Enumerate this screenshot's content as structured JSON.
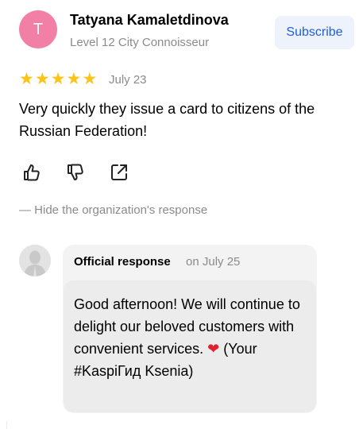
{
  "author": {
    "initial": "T",
    "name": "Tatyana Kamaletdinova",
    "level": "Level 12 City Connoisseur",
    "avatar_color": "#f27fa6"
  },
  "subscribe_label": "Subscribe",
  "rating": {
    "stars": 5,
    "max": 5,
    "star_glyph": "★"
  },
  "review": {
    "date": "July 23",
    "text": "Very quickly they issue a card to citizens of the Russian Federation!"
  },
  "actions": {
    "like_icon": "thumbs-up-icon",
    "dislike_icon": "thumbs-down-icon",
    "share_icon": "share-icon"
  },
  "hide_response_label": "— Hide the organization's response",
  "response": {
    "label": "Official response",
    "date": "on July 25",
    "text_before": "Good afternoon! We will continue to delight our beloved customers with convenient services.",
    "heart": "❤",
    "text_after": "(Your #KaspiГид Ksenia)"
  },
  "colors": {
    "accent": "#1f5fd8",
    "star": "#fcc419",
    "muted": "#8b8b8b",
    "heart": "#e0202e"
  }
}
